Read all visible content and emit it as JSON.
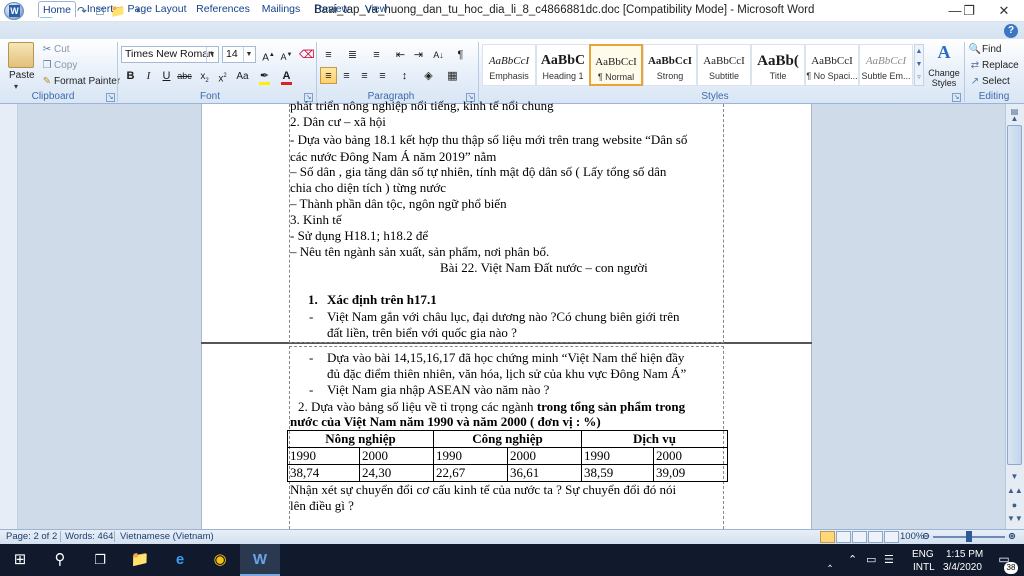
{
  "window": {
    "title": "Baai_tap_va_huong_dan_tu_hoc_dia_li_8_c4866881dc.doc [Compatibility Mode] - Microsoft Word"
  },
  "tabs": [
    "Home",
    "Insert",
    "Page Layout",
    "References",
    "Mailings",
    "Review",
    "View"
  ],
  "active_tab": "Home",
  "ribbon": {
    "clipboard": {
      "label": "Clipboard",
      "paste": "Paste",
      "cut": "Cut",
      "copy": "Copy",
      "format_painter": "Format Painter"
    },
    "font": {
      "label": "Font",
      "font_name": "Times New Roman",
      "font_size": "14"
    },
    "paragraph": {
      "label": "Paragraph"
    },
    "styles": {
      "label": "Styles",
      "items": [
        {
          "sample": "AaBbCcI",
          "name": "Emphasis"
        },
        {
          "sample": "AaBbC",
          "name": "Heading 1"
        },
        {
          "sample": "AaBbCcI",
          "name": "¶ Normal"
        },
        {
          "sample": "AaBbCcI",
          "name": "Strong"
        },
        {
          "sample": "AaBbCcI",
          "name": "Subtitle"
        },
        {
          "sample": "AaBb(",
          "name": "Title"
        },
        {
          "sample": "AaBbCcI",
          "name": "¶ No Spaci..."
        },
        {
          "sample": "AaBbCcI",
          "name": "Subtle Em..."
        }
      ],
      "change_styles": "Change Styles"
    },
    "editing": {
      "label": "Editing",
      "find": "Find",
      "replace": "Replace",
      "select": "Select"
    }
  },
  "document": {
    "page1_lines": [
      "phát triển nông nghiệp nổi tiếng, kinh tế nổi chung",
      "2. Dân cư – xã hội",
      "- Dựa vào bảng 18.1 kết hợp thu thập số liệu mới trên trang website “Dân số",
      "các nước Đông Nam Á năm 2019” nằm",
      "– Số dân , gia tăng dân số tự nhiên, tính mật độ dân số ( Lấy tổng số dân",
      "chia cho diện tích ) từng nước",
      "– Thành phần dân tộc, ngôn ngữ phổ biến",
      "3. Kinh tế",
      "- Sử dụng H18.1; h18.2 để",
      "– Nêu tên ngành sản xuất, sản phẩm, nơi phân bố."
    ],
    "lesson_title": "Bài 22. Việt Nam Đất nước – con người",
    "item1_heading": "Xác định trên h17.1",
    "item1_number": "1.",
    "bullet1_line1": "Việt Nam gắn với châu lục, đại dương nào ?Có chung biên giới trên",
    "bullet1_line2": "đất liền, trên biển với quốc gia nào ?",
    "bullet2_line1": "Dựa vào bài 14,15,16,17 đã học  chứng minh “Việt Nam thể hiện đầy",
    "bullet2_line2": "đủ đặc điểm thiên nhiên, văn hóa, lịch sử của khu vực Đông Nam Á”",
    "bullet3": "Việt Nam gia nhập ASEAN vào năm nào ?",
    "q2_prefix": "2. Dựa vào bảng số liệu về tỉ trọng các ngành ",
    "q2_bold1": "trong tổng sản phẩm trong",
    "q2_bold2": "nước của Việt Nam năm 1990 và năm 2000 ( đơn vị : %)",
    "table": {
      "headers": [
        "Nông nghiệp",
        "Công nghiệp",
        "Dịch vụ"
      ],
      "years": [
        "1990",
        "2000",
        "1990",
        "2000",
        "1990",
        "2000"
      ],
      "values": [
        "38,74",
        "24,30",
        "22,67",
        "36,61",
        "38,59",
        "39,09"
      ]
    },
    "closing_line1": "Nhận xét sự chuyển đổi cơ cấu kinh tế của nước ta ? Sự chuyển đổi đó nói",
    "closing_line2": "lên điều gì ?"
  },
  "statusbar": {
    "page": "Page: 2 of 2",
    "words": "Words: 464",
    "language": "Vietnamese (Vietnam)",
    "zoom": "100%"
  },
  "taskbar": {
    "language": "ENG",
    "layout": "INTL",
    "time": "1:15 PM",
    "date": "3/4/2020",
    "notification_count": "38"
  }
}
